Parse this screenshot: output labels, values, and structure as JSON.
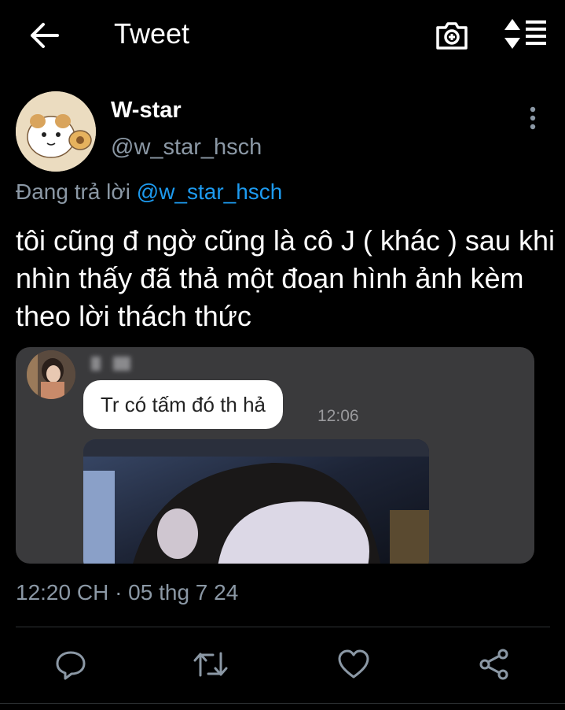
{
  "header": {
    "title": "Tweet",
    "back_icon": "arrow-left-icon",
    "camera_icon": "camera-icon",
    "sort_icon": "sort-icon"
  },
  "tweet": {
    "author": {
      "display_name": "W-star",
      "username": "@w_star_hsch"
    },
    "reply_prefix": "Đang trả lời",
    "reply_to": "@w_star_hsch",
    "text": "tôi cũng đ ngờ cũng là cô J ( khác ) sau khi nhìn thấy đã thả một đoạn hình ảnh kèm theo lời thách thức",
    "media": {
      "message_text": "Tr có tấm đó th hả",
      "message_time": "12:06"
    },
    "timestamp": "12:20 CH · 05 thg 7 24"
  },
  "actions": {
    "reply_icon": "reply-icon",
    "retweet_icon": "retweet-icon",
    "like_icon": "heart-icon",
    "share_icon": "share-icon"
  },
  "colors": {
    "background": "#000000",
    "text": "#ffffff",
    "secondary": "#8b98a5",
    "accent": "#1d9bf0"
  }
}
